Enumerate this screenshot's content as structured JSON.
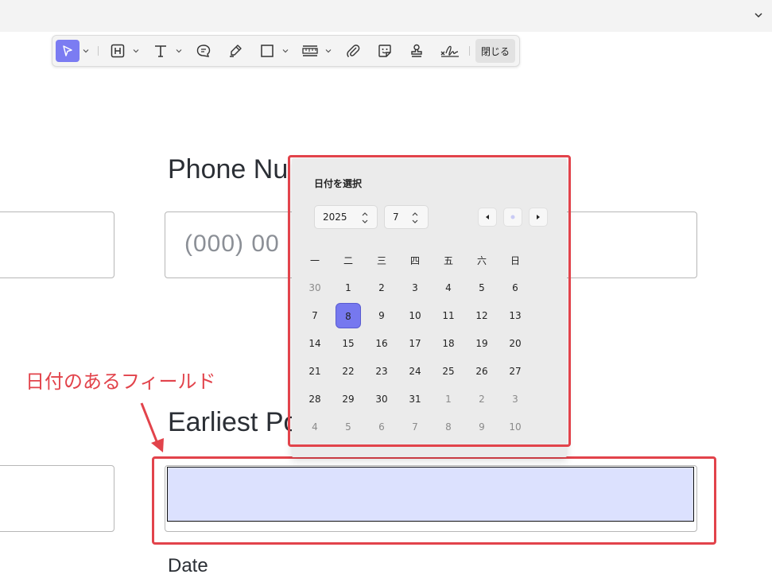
{
  "toolbar": {
    "close_label": "閉じる",
    "tools": [
      "select-arrow-icon",
      "text-box-icon",
      "text-icon",
      "comment-icon",
      "highlighter-icon",
      "rectangle-icon",
      "ruler-icon",
      "paperclip-icon",
      "sticker-icon",
      "stamp-icon",
      "signature-icon"
    ]
  },
  "form": {
    "phone_label": "Phone Nu",
    "phone_placeholder": "(000) 00",
    "earliest_label": "Earliest Po",
    "date_caption": "Date"
  },
  "annotation": {
    "text": "日付のあるフィールド"
  },
  "calendar": {
    "title": "日付を選択",
    "year": "2025",
    "month": "7",
    "weekdays": [
      "一",
      "二",
      "三",
      "四",
      "五",
      "六",
      "日"
    ],
    "weeks": [
      [
        {
          "d": "30",
          "out": true
        },
        {
          "d": "1"
        },
        {
          "d": "2"
        },
        {
          "d": "3"
        },
        {
          "d": "4"
        },
        {
          "d": "5"
        },
        {
          "d": "6"
        }
      ],
      [
        {
          "d": "7"
        },
        {
          "d": "8",
          "sel": true
        },
        {
          "d": "9"
        },
        {
          "d": "10"
        },
        {
          "d": "11"
        },
        {
          "d": "12"
        },
        {
          "d": "13"
        }
      ],
      [
        {
          "d": "14"
        },
        {
          "d": "15"
        },
        {
          "d": "16"
        },
        {
          "d": "17"
        },
        {
          "d": "18"
        },
        {
          "d": "19"
        },
        {
          "d": "20"
        }
      ],
      [
        {
          "d": "21"
        },
        {
          "d": "22"
        },
        {
          "d": "23"
        },
        {
          "d": "24"
        },
        {
          "d": "25"
        },
        {
          "d": "26"
        },
        {
          "d": "27"
        }
      ],
      [
        {
          "d": "28"
        },
        {
          "d": "29"
        },
        {
          "d": "30"
        },
        {
          "d": "31"
        },
        {
          "d": "1",
          "out": true
        },
        {
          "d": "2",
          "out": true
        },
        {
          "d": "3",
          "out": true
        }
      ],
      [
        {
          "d": "4",
          "out": true
        },
        {
          "d": "5",
          "out": true
        },
        {
          "d": "6",
          "out": true
        },
        {
          "d": "7",
          "out": true
        },
        {
          "d": "8",
          "out": true
        },
        {
          "d": "9",
          "out": true
        },
        {
          "d": "10",
          "out": true
        }
      ]
    ]
  },
  "colors": {
    "accent": "#7678ef",
    "annotation": "#e2434b",
    "date_field_fill": "#dce1fe"
  }
}
